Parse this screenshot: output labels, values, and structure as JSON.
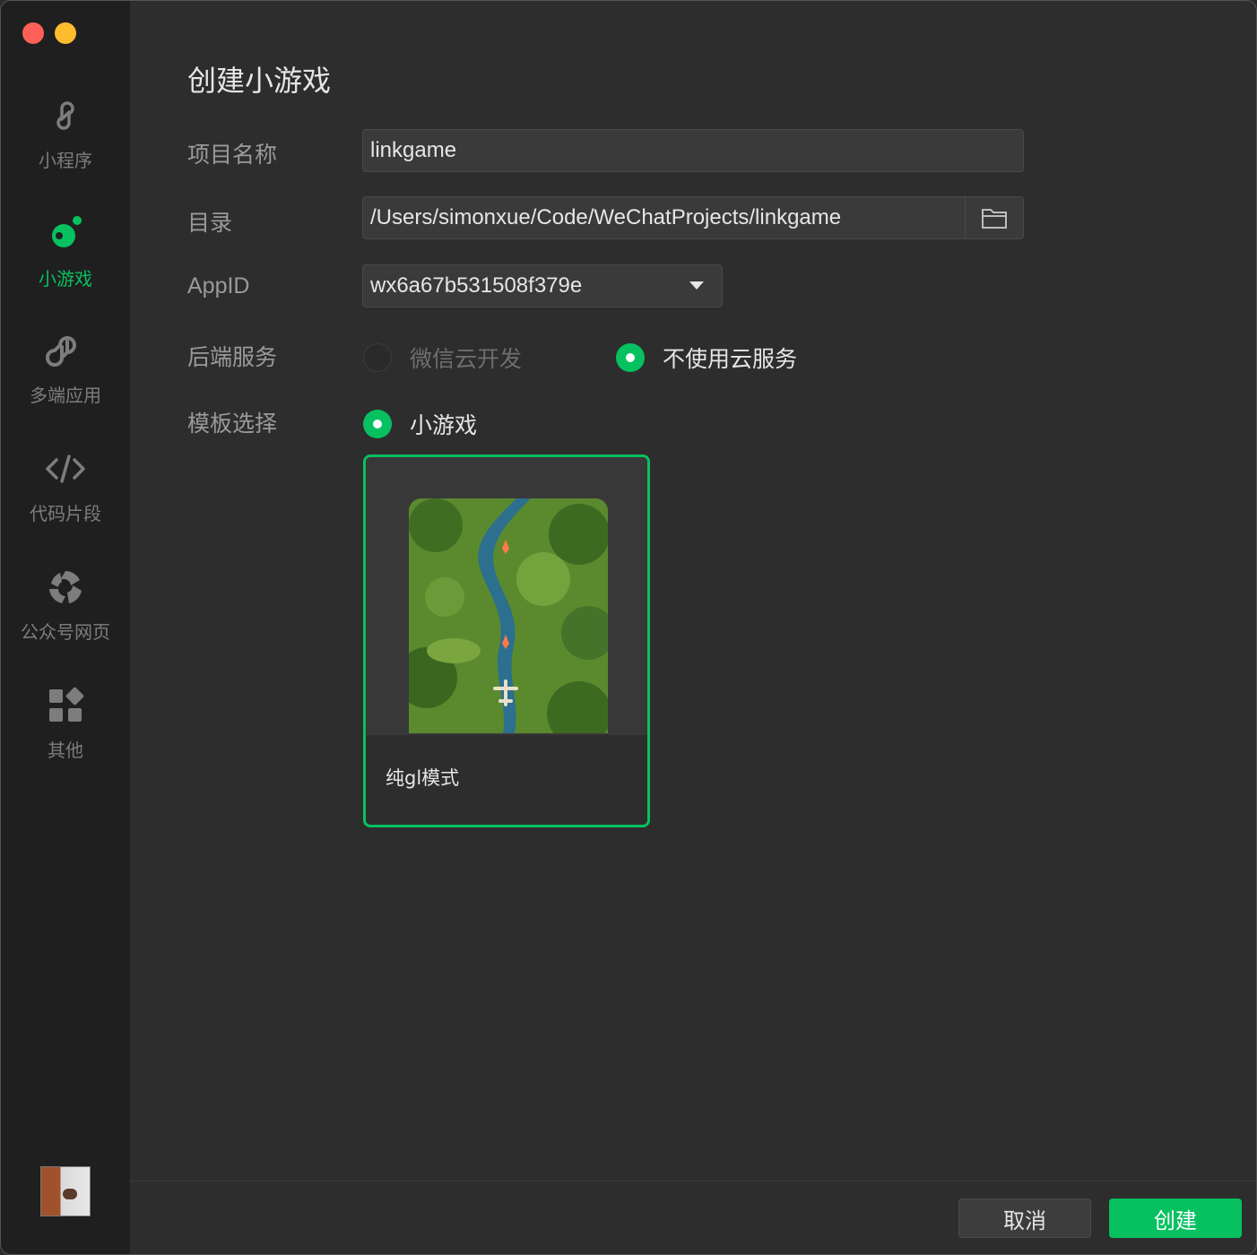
{
  "window": {
    "title": "创建小游戏"
  },
  "sidebar": {
    "items": [
      {
        "label": "小程序",
        "icon": "miniprogram-icon",
        "active": false
      },
      {
        "label": "小游戏",
        "icon": "minigame-icon",
        "active": true
      },
      {
        "label": "多端应用",
        "icon": "multiplatform-icon",
        "active": false
      },
      {
        "label": "代码片段",
        "icon": "code-icon",
        "active": false
      },
      {
        "label": "公众号网页",
        "icon": "official-account-icon",
        "active": false
      },
      {
        "label": "其他",
        "icon": "apps-grid-icon",
        "active": false
      }
    ]
  },
  "form": {
    "project_name": {
      "label": "项目名称",
      "value": "linkgame"
    },
    "directory": {
      "label": "目录",
      "value": "/Users/simonxue/Code/WeChatProjects/linkgame"
    },
    "appid": {
      "label": "AppID",
      "value": "wx6a67b531508f379e"
    },
    "backend": {
      "label": "后端服务",
      "options": [
        {
          "label": "微信云开发",
          "selected": false,
          "disabled": true
        },
        {
          "label": "不使用云服务",
          "selected": true,
          "disabled": false
        }
      ]
    },
    "template": {
      "label": "模板选择",
      "category": "小游戏",
      "cards": [
        {
          "label": "纯gl模式",
          "selected": true
        }
      ]
    }
  },
  "footer": {
    "cancel_label": "取消",
    "create_label": "创建"
  },
  "colors": {
    "accent": "#07c160",
    "sidebar_bg": "#1f1f1f",
    "panel_bg": "#2d2d2d"
  }
}
